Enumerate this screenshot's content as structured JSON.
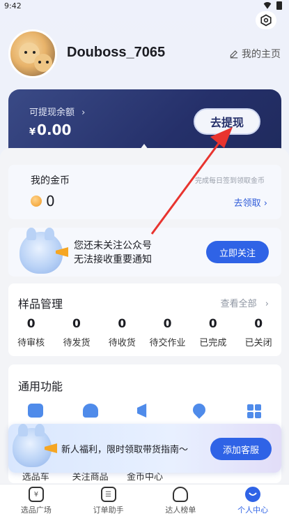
{
  "status_bar": {
    "time": "9:42"
  },
  "profile": {
    "username": "Douboss_7065",
    "homepage_label": "我的主页"
  },
  "balance": {
    "label": "可提现余额",
    "currency": "¥",
    "amount": "0.00",
    "withdraw_label": "去提现"
  },
  "coins": {
    "title": "我的金币",
    "value": "0",
    "hint": "完成每日签到领取金币",
    "claim_label": "去领取"
  },
  "notify": {
    "line1": "您还未关注公众号",
    "line2": "无法接收重要通知",
    "follow_label": "立即关注"
  },
  "samples": {
    "title": "样品管理",
    "view_all": "查看全部",
    "stats": [
      {
        "num": "0",
        "label": "待审核"
      },
      {
        "num": "0",
        "label": "待发货"
      },
      {
        "num": "0",
        "label": "待收货"
      },
      {
        "num": "0",
        "label": "待交作业"
      },
      {
        "num": "0",
        "label": "已完成"
      },
      {
        "num": "0",
        "label": "已关闭"
      }
    ]
  },
  "tools": {
    "title": "通用功能",
    "items": [
      "选品车",
      "关注商品",
      "金币中心",
      "",
      ""
    ],
    "colors": [
      "#4f8bea",
      "#4f8bea",
      "#4f8bea",
      "#4f8bea",
      "#4f8bea"
    ]
  },
  "banner": {
    "text": "新人福利，限时领取带货指南～",
    "service_label": "添加客服"
  },
  "tabs": [
    {
      "label": "选品广场",
      "icon": "yen-icon"
    },
    {
      "label": "订单助手",
      "icon": "order-icon"
    },
    {
      "label": "达人榜单",
      "icon": "trophy-icon"
    },
    {
      "label": "个人中心",
      "icon": "profile-icon"
    }
  ],
  "colors": {
    "accent": "#2f63e6",
    "card_dark": "#25306a",
    "annotation": "#e8342f"
  }
}
